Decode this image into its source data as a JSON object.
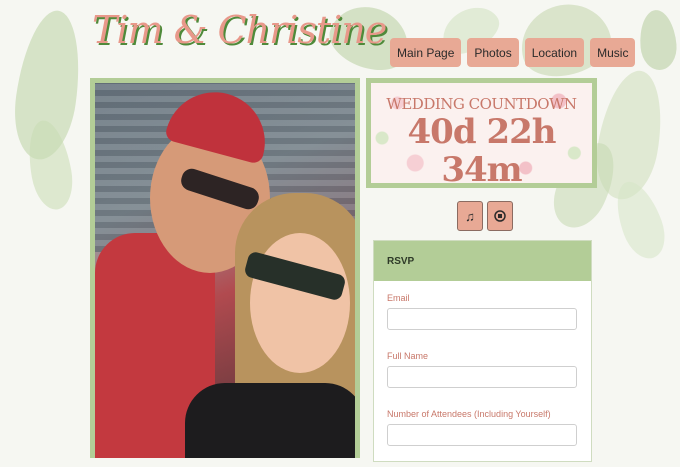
{
  "site_title": "Tim & Christine",
  "nav": {
    "items": [
      "Main Page",
      "Photos",
      "Location",
      "Music"
    ]
  },
  "countdown": {
    "title": "WEDDING COUNTDOWN",
    "time": "40d 22h 34m"
  },
  "audio": {
    "play_icon": "music-note-icon",
    "stop_icon": "stop-icon"
  },
  "rsvp": {
    "header": "RSVP",
    "fields": [
      {
        "label": "Email",
        "value": ""
      },
      {
        "label": "Full Name",
        "value": ""
      },
      {
        "label": "Number of Attendees (Including Yourself)",
        "value": ""
      }
    ]
  },
  "colors": {
    "accent": "#e8a995",
    "frame": "#b3cd97",
    "text_accent": "#c8786a"
  }
}
